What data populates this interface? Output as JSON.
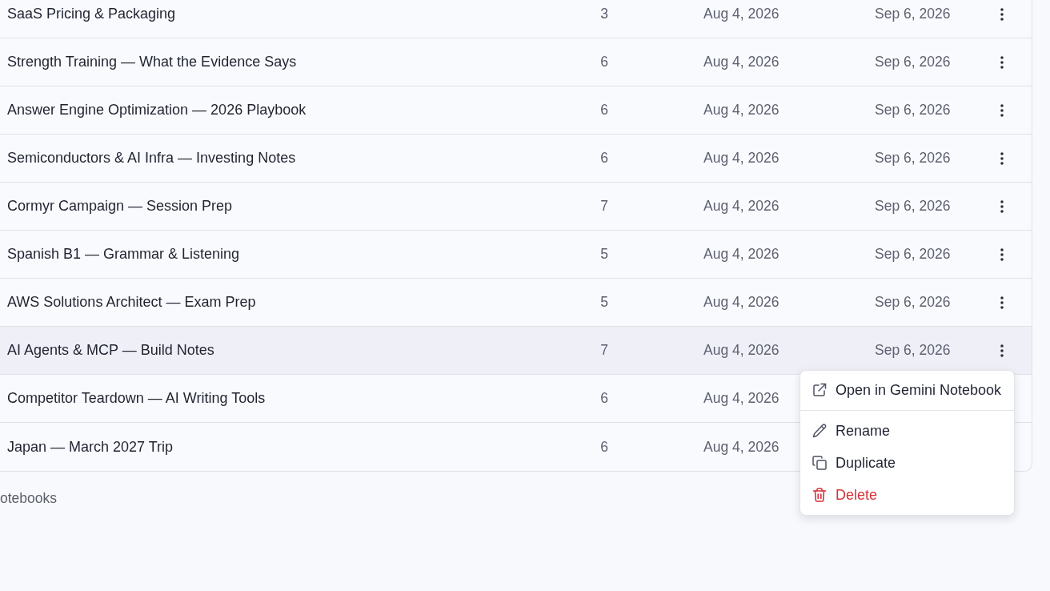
{
  "notebooks": {
    "rows": [
      {
        "cells": [
          "SaaS Pricing & Packaging",
          "3",
          "Aug 4, 2026",
          "Sep 6, 2026"
        ],
        "selected": false
      },
      {
        "cells": [
          "Strength Training — What the Evidence Says",
          "6",
          "Aug 4, 2026",
          "Sep 6, 2026"
        ],
        "selected": false
      },
      {
        "cells": [
          "Answer Engine Optimization — 2026 Playbook",
          "6",
          "Aug 4, 2026",
          "Sep 6, 2026"
        ],
        "selected": false
      },
      {
        "cells": [
          "Semiconductors & AI Infra — Investing Notes",
          "6",
          "Aug 4, 2026",
          "Sep 6, 2026"
        ],
        "selected": false
      },
      {
        "cells": [
          "Cormyr Campaign — Session Prep",
          "7",
          "Aug 4, 2026",
          "Sep 6, 2026"
        ],
        "selected": false
      },
      {
        "cells": [
          "Spanish B1 — Grammar & Listening",
          "5",
          "Aug 4, 2026",
          "Sep 6, 2026"
        ],
        "selected": false
      },
      {
        "cells": [
          "AWS Solutions Architect — Exam Prep",
          "5",
          "Aug 4, 2026",
          "Sep 6, 2026"
        ],
        "selected": false
      },
      {
        "cells": [
          "AI Agents & MCP — Build Notes",
          "7",
          "Aug 4, 2026",
          "Sep 6, 2026"
        ],
        "selected": true
      },
      {
        "cells": [
          "Competitor Teardown — AI Writing Tools",
          "6",
          "Aug 4, 2026"
        ],
        "selected": false
      },
      {
        "cells": [
          "Japan — March 2027 Trip",
          "6",
          "Aug 4, 2026"
        ],
        "selected": false
      }
    ],
    "footer": "otebooks"
  },
  "context_menu": {
    "items": [
      {
        "kind": "external",
        "label": "Open in Gemini Notebook"
      },
      {
        "kind": "separator"
      },
      {
        "kind": "rename",
        "label": "Rename"
      },
      {
        "kind": "duplicate",
        "label": "Duplicate"
      },
      {
        "kind": "delete",
        "label": "Delete"
      }
    ]
  }
}
